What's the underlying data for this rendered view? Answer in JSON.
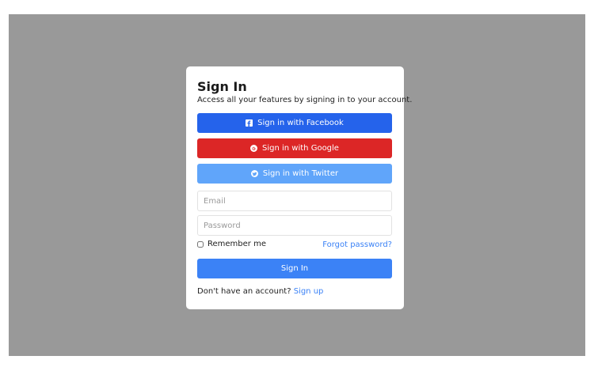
{
  "card": {
    "title": "Sign In",
    "subtitle": "Access all your features by signing in to your account."
  },
  "social": {
    "facebook_label": "Sign in with Facebook",
    "google_label": "Sign in with Google",
    "twitter_label": "Sign in with Twitter",
    "facebook_icon": "facebook-icon",
    "google_icon": "google-icon",
    "twitter_icon": "twitter-icon"
  },
  "form": {
    "email_placeholder": "Email",
    "email_value": "",
    "password_placeholder": "Password",
    "password_value": "",
    "remember_label": "Remember me",
    "remember_checked": false,
    "forgot_label": "Forgot password?",
    "submit_label": "Sign In"
  },
  "footer": {
    "prompt": "Don't have an account?",
    "signup_label": "Sign up"
  },
  "colors": {
    "backdrop": "#999999",
    "facebook": "#2563eb",
    "google": "#dc2626",
    "twitter": "#60a5fa",
    "primary": "#3b82f6",
    "link": "#3b82f6"
  }
}
